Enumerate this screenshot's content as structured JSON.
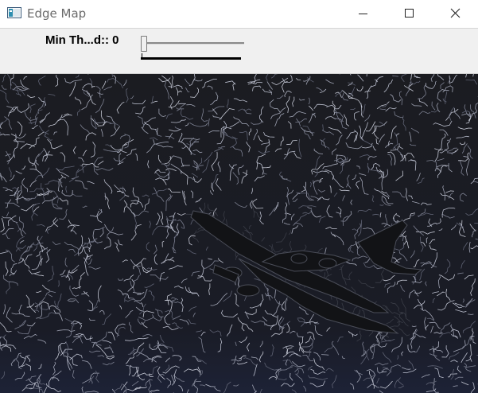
{
  "window": {
    "title": "Edge Map",
    "controls": {
      "minimize": "minimize-icon",
      "maximize": "maximize-icon",
      "close": "close-icon"
    }
  },
  "trackbar": {
    "label": "Min Th...d:: 0",
    "value": 0
  },
  "image": {
    "description_icon": "edge-map-image",
    "colors": {
      "background": "#1a1b22",
      "edges": "#c9ccd8",
      "edges_dim": "#6f7385",
      "plane": "#111214"
    }
  }
}
